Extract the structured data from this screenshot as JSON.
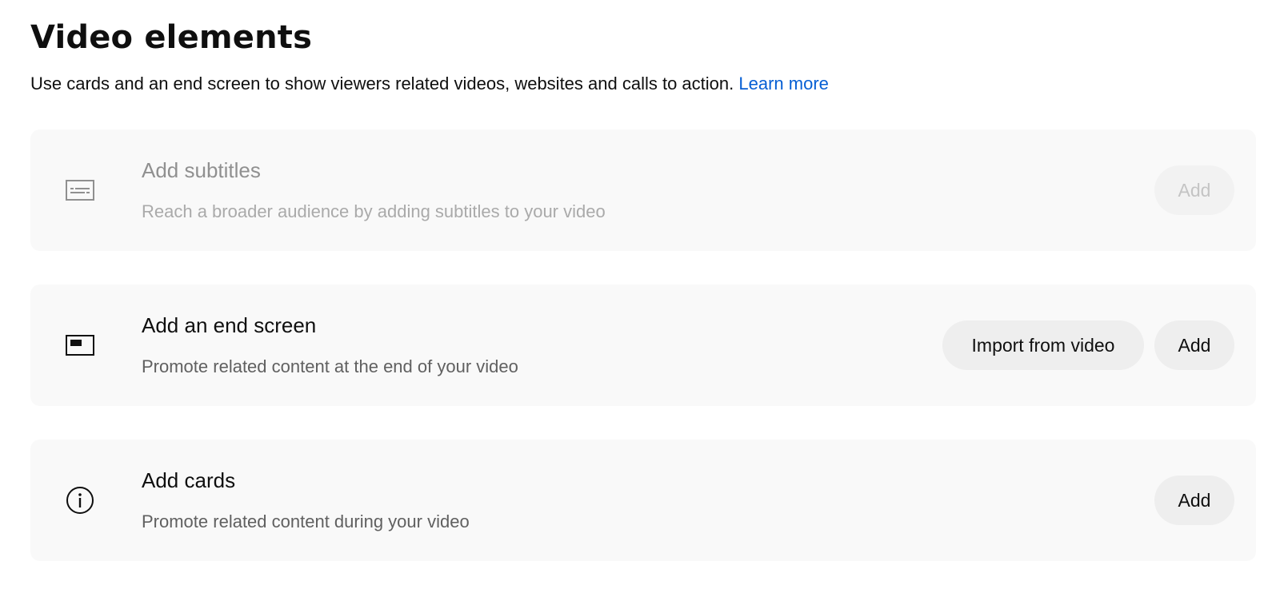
{
  "header": {
    "title": "Video elements",
    "description": "Use cards and an end screen to show viewers related videos, websites and calls to action.",
    "learn_more": "Learn more"
  },
  "elements": [
    {
      "icon": "subtitles-icon",
      "title": "Add subtitles",
      "subtitle": "Reach a broader audience by adding subtitles to your video",
      "add_label": "Add",
      "disabled": true
    },
    {
      "icon": "end-screen-icon",
      "title": "Add an end screen",
      "subtitle": "Promote related content at the end of your video",
      "import_label": "Import from video",
      "add_label": "Add",
      "disabled": false
    },
    {
      "icon": "info-icon",
      "title": "Add cards",
      "subtitle": "Promote related content during your video",
      "add_label": "Add",
      "disabled": false
    }
  ],
  "colors": {
    "link": "#065fd4",
    "card_background": "#f9f9f9",
    "button_background": "#eeeeee"
  }
}
